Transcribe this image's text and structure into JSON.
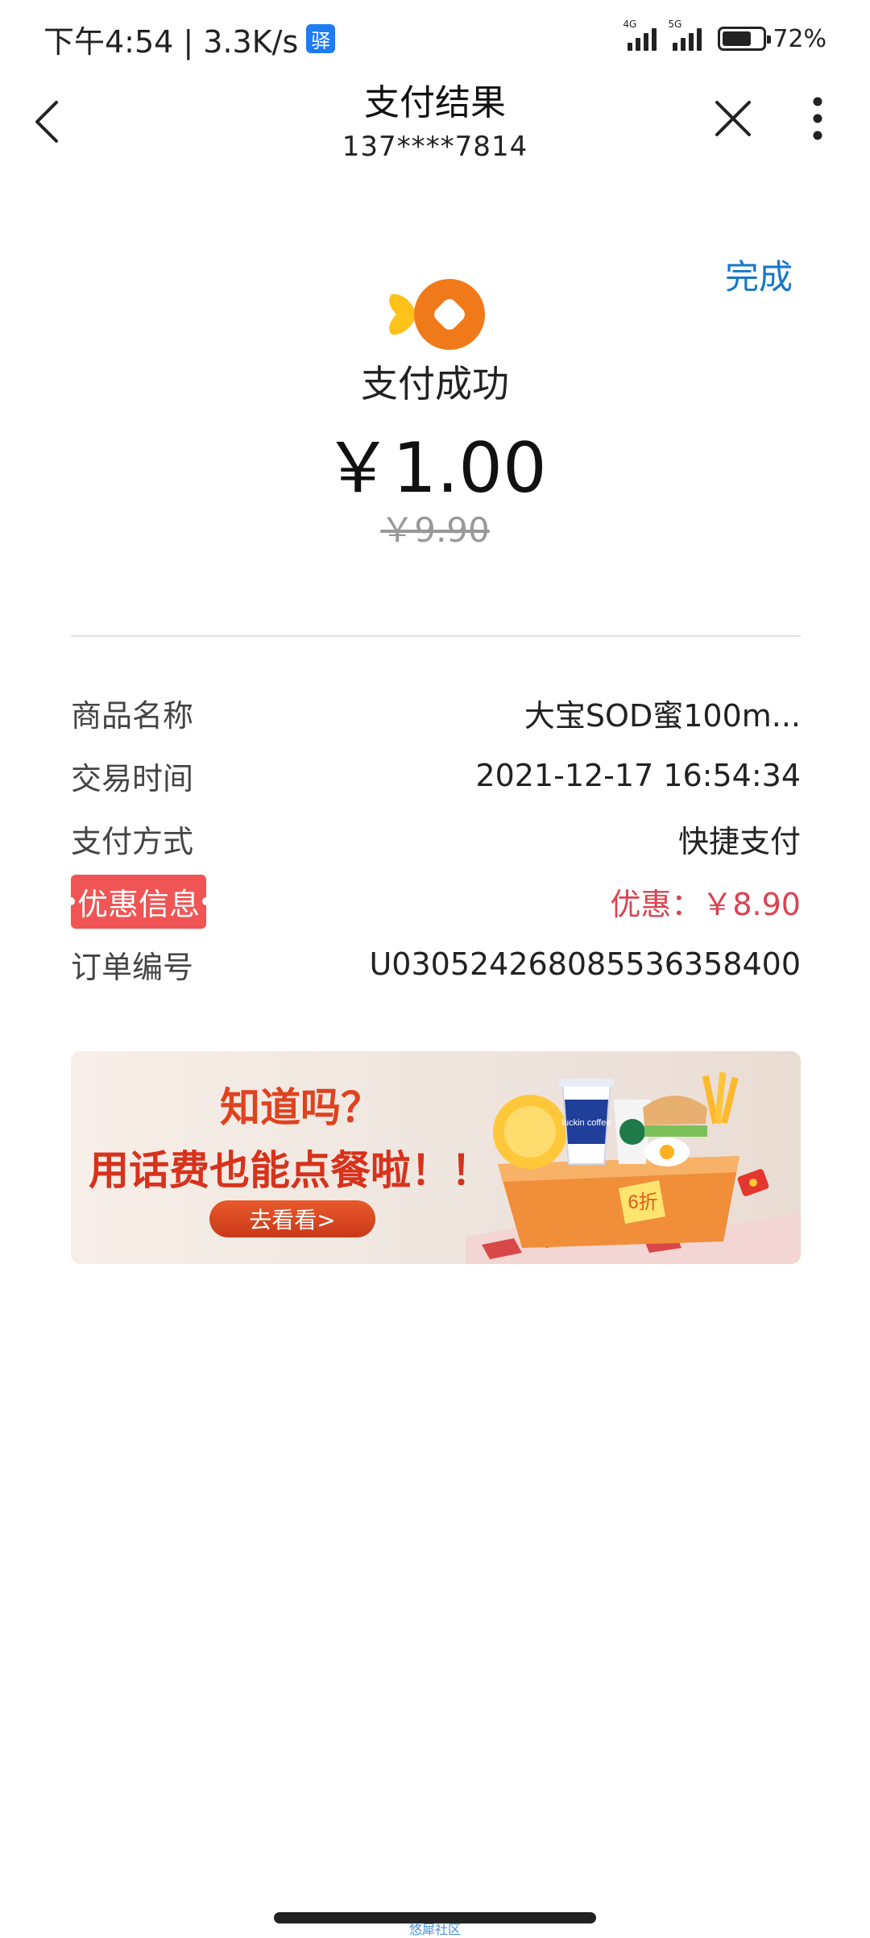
{
  "status_bar": {
    "time_speed": "下午4:54 | 3.3K/s",
    "app_badge": "驿",
    "signal1_tag": "4G",
    "signal2_tag": "5G",
    "battery_percent": "72%",
    "battery_level": 0.72
  },
  "nav": {
    "title": "支付结果",
    "subtitle": "137****7814"
  },
  "result": {
    "done_label": "完成",
    "status_text": "支付成功",
    "amount": "￥1.00",
    "original_amount": "￥9.90"
  },
  "details": [
    {
      "label": "商品名称",
      "value": "大宝SOD蜜100m...",
      "highlight": false
    },
    {
      "label": "交易时间",
      "value": "2021-12-17 16:54:34",
      "highlight": false
    },
    {
      "label": "支付方式",
      "value": "快捷支付",
      "highlight": false
    },
    {
      "label": "优惠信息",
      "value": "优惠：￥8.90",
      "highlight": true
    },
    {
      "label": "订单编号",
      "value": "U030524268085536358400",
      "highlight": false
    }
  ],
  "banner": {
    "headline": "知道吗？",
    "subheadline": "用话费也能点餐啦！！",
    "button_label": "去看看>",
    "cup_text": "luckin coffee",
    "tag_text": "6折"
  },
  "footer": {
    "watermark": "悠犀社区"
  },
  "colors": {
    "accent_blue": "#1677c9",
    "promo_red": "#d94452",
    "logo_orange": "#f07a1a",
    "logo_yellow": "#ffc21a"
  }
}
